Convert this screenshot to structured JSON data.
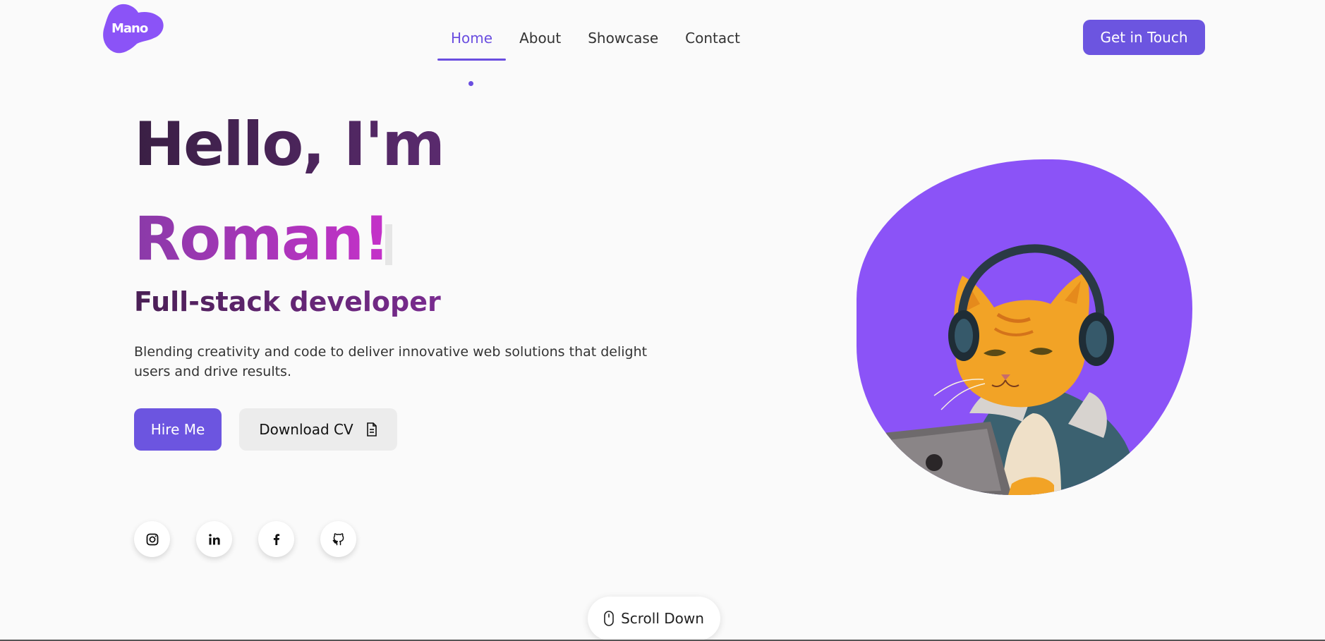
{
  "brand": {
    "logo_text": "Mano",
    "accent": "#6c55e0",
    "blob_color": "#8b53f7"
  },
  "nav": {
    "items": [
      {
        "label": "Home",
        "active": true
      },
      {
        "label": "About",
        "active": false
      },
      {
        "label": "Showcase",
        "active": false
      },
      {
        "label": "Contact",
        "active": false
      }
    ],
    "cta_label": "Get in Touch"
  },
  "hero": {
    "greeting": "Hello, I'm",
    "name": "Roman!",
    "role": "Full-stack developer",
    "blurb": "Blending creativity and code to deliver innovative web solutions that delight users and drive results.",
    "hire_label": "Hire Me",
    "cv_label": "Download CV",
    "cv_icon": "document-icon"
  },
  "socials": [
    {
      "name": "instagram-icon"
    },
    {
      "name": "linkedin-icon"
    },
    {
      "name": "facebook-icon"
    },
    {
      "name": "github-icon"
    }
  ],
  "scroll": {
    "label": "Scroll Down",
    "icon": "mouse-icon"
  },
  "illustration": {
    "subject": "cat-with-headphones-icon"
  }
}
